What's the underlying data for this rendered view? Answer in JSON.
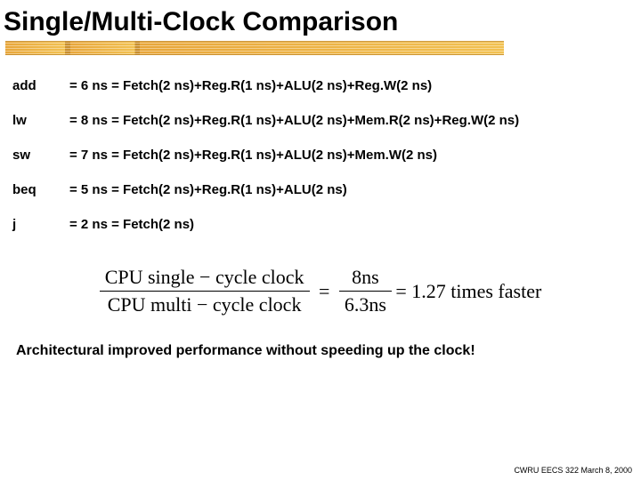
{
  "title": "Single/Multi-Clock Comparison",
  "rows": [
    {
      "name": "add",
      "formula": "= 6 ns = Fetch(2 ns)+Reg.R(1 ns)+ALU(2 ns)+Reg.W(2 ns)"
    },
    {
      "name": "lw",
      "formula": "= 8 ns = Fetch(2 ns)+Reg.R(1 ns)+ALU(2 ns)+Mem.R(2 ns)+Reg.W(2 ns)"
    },
    {
      "name": "sw",
      "formula": "= 7 ns = Fetch(2 ns)+Reg.R(1 ns)+ALU(2 ns)+Mem.W(2 ns)"
    },
    {
      "name": "beq",
      "formula": "= 5 ns = Fetch(2 ns)+Reg.R(1 ns)+ALU(2 ns)"
    },
    {
      "name": "j",
      "formula": "= 2 ns = Fetch(2 ns)"
    }
  ],
  "equation": {
    "frac1": {
      "num": "CPU single − cycle clock",
      "den": "CPU multi − cycle clock"
    },
    "frac2": {
      "num": "8ns",
      "den": "6.3ns"
    },
    "tail": "= 1.27 times faster"
  },
  "conclusion": "Architectural improved performance without speeding up the clock!",
  "footer": "CWRU EECS 322 March 8, 2000"
}
